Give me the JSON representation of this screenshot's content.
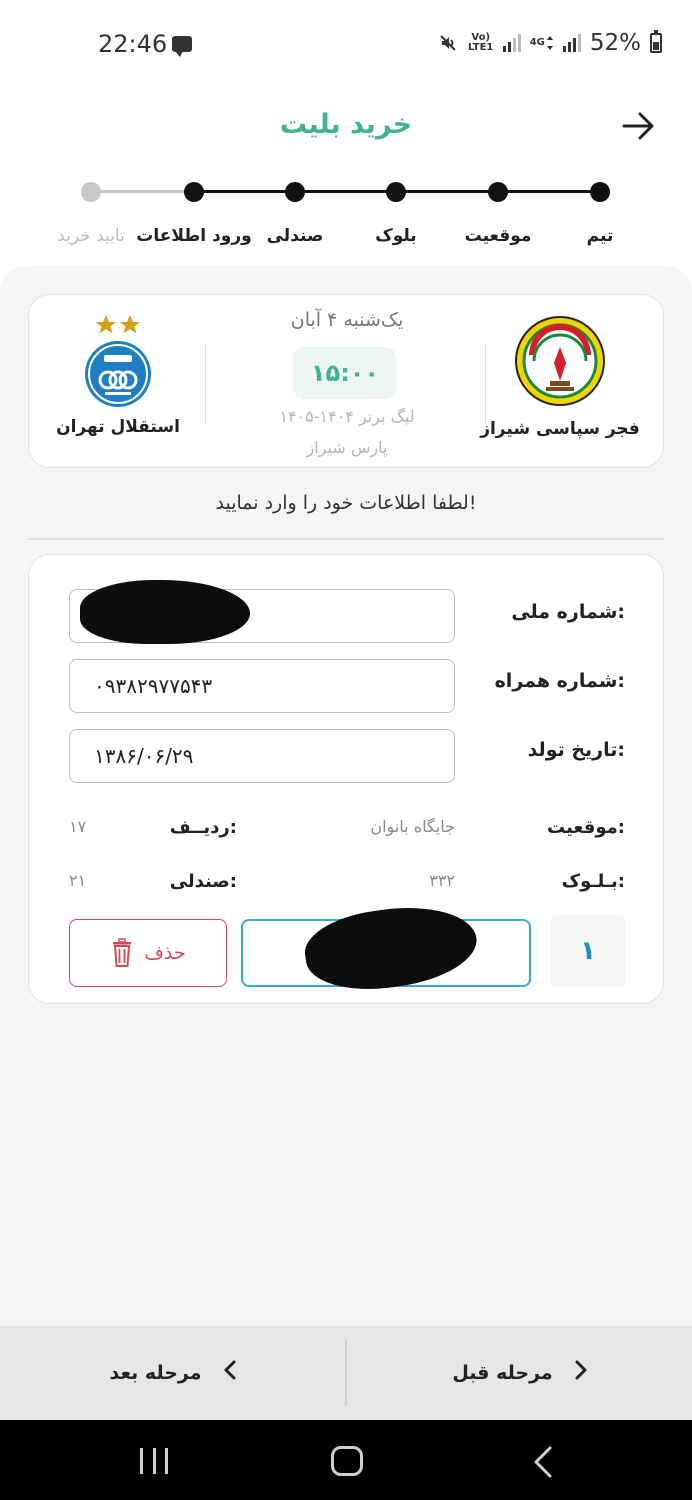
{
  "status_bar": {
    "time": "22:46",
    "lte_label": "Vo) LTE1",
    "net_label": "4G",
    "battery_text": "52%"
  },
  "header": {
    "title": "خرید بلیت"
  },
  "stepper": {
    "steps": [
      {
        "label": "تیم",
        "done": true
      },
      {
        "label": "موقعیت",
        "done": true
      },
      {
        "label": "بلوک",
        "done": true
      },
      {
        "label": "صندلی",
        "done": true
      },
      {
        "label": "ورود اطلاعات",
        "done": true
      },
      {
        "label": "تایید خرید",
        "done": false
      }
    ]
  },
  "match": {
    "home_team": "فجر سپاسی شیراز",
    "away_team": "استقلال تهران",
    "date": "یک‌شنبه ۴ آبان",
    "time": "۱۵:۰۰",
    "league": "لیگ برتر ۱۴۰۴-۱۴۰۵",
    "stadium": "پارس شیراز"
  },
  "instruction": "لطفا اطلاعات خود را وارد نمایید!",
  "form": {
    "national_id_label": "شماره ملی:",
    "national_id_value": "",
    "mobile_label": "شماره همراه:",
    "mobile_value": "۰۹۳۸۲۹۷۷۵۴۳",
    "birthdate_label": "تاریخ تولد:",
    "birthdate_value": "۱۳۸۶/۰۶/۲۹",
    "position_label": "موقعیت:",
    "position_value": "جایگاه بانوان",
    "row_label": "ردیــف:",
    "row_value": "۱۷",
    "block_label": "بـلـوک:",
    "block_value": "۳۳۲",
    "seat_label": "صندلی:",
    "seat_value": "۲۱",
    "ticket_index": "۱",
    "delete_label": "حذف"
  },
  "bottom_nav": {
    "prev_label": "مرحله قبل",
    "next_label": "مرحله بعد"
  },
  "colors": {
    "accent": "#3fb48f",
    "danger": "#d44b56",
    "info": "#39a9d6"
  }
}
